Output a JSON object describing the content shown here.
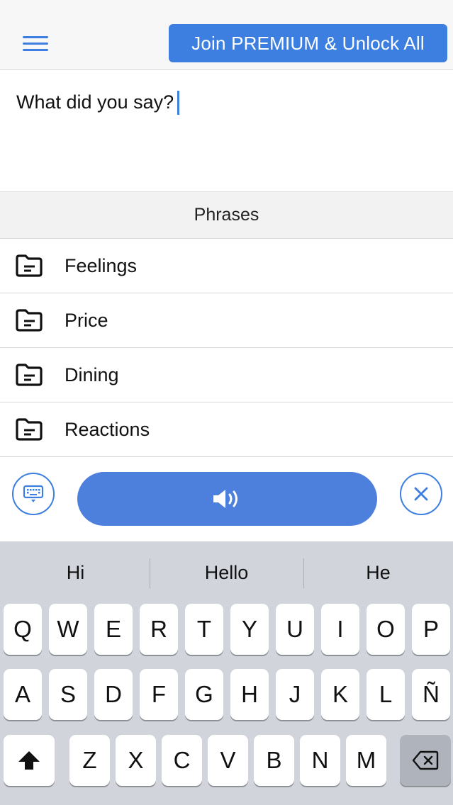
{
  "header": {
    "menu_icon": "hamburger-icon",
    "premium_label": "Join PREMIUM & Unlock All"
  },
  "editor": {
    "text": "What did you say?"
  },
  "phrases": {
    "title": "Phrases",
    "items": [
      {
        "label": "Feelings",
        "icon": "folder-icon"
      },
      {
        "label": "Price",
        "icon": "folder-icon"
      },
      {
        "label": "Dining",
        "icon": "folder-icon"
      },
      {
        "label": "Reactions",
        "icon": "folder-icon"
      }
    ]
  },
  "actions": {
    "keyboard_icon": "keyboard-icon",
    "speak_icon": "speaker-icon",
    "clear_icon": "close-icon"
  },
  "keyboard": {
    "suggestions": [
      "Hi",
      "Hello",
      "He"
    ],
    "row1": [
      "Q",
      "W",
      "E",
      "R",
      "T",
      "Y",
      "U",
      "I",
      "O",
      "P"
    ],
    "row2": [
      "A",
      "S",
      "D",
      "F",
      "G",
      "H",
      "J",
      "K",
      "L",
      "Ñ"
    ],
    "row3": [
      "Z",
      "X",
      "C",
      "V",
      "B",
      "N",
      "M"
    ],
    "shift_icon": "shift-icon",
    "backspace_icon": "backspace-icon"
  },
  "colors": {
    "accent": "#3c7fe0",
    "speak_button": "#4d7fdc",
    "keyboard_bg": "#d1d4da"
  }
}
